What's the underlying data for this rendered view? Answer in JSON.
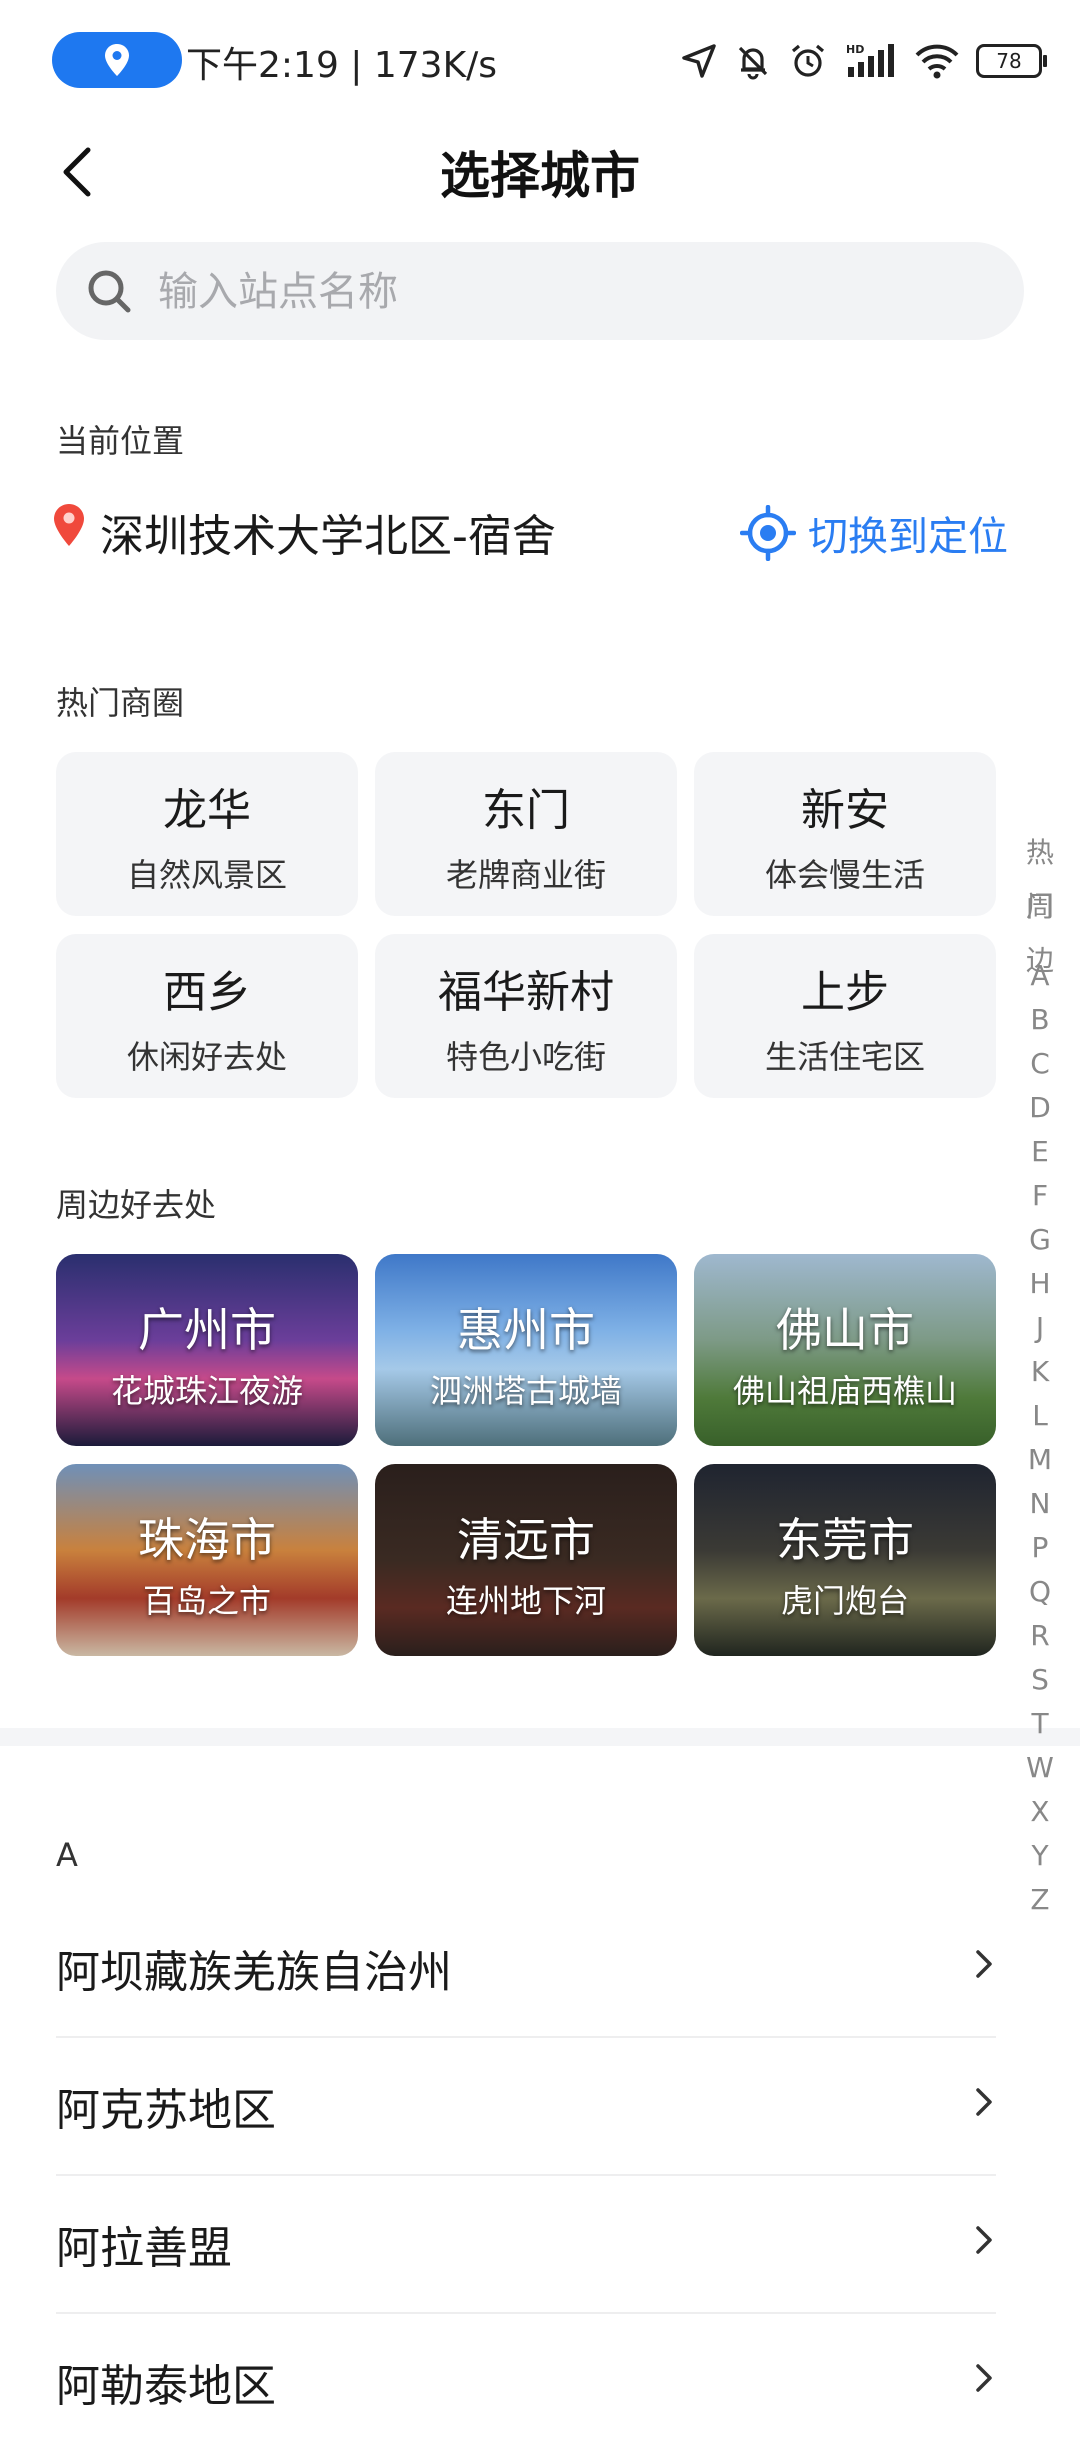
{
  "status_bar": {
    "text": "下午2:19 | 173K/s",
    "battery": "78",
    "icons": [
      "location-arrow-icon",
      "bell-off-icon",
      "alarm-icon",
      "hd-signal-icon",
      "wifi-icon",
      "battery-icon"
    ]
  },
  "header": {
    "title": "选择城市"
  },
  "search": {
    "placeholder": "输入站点名称"
  },
  "current": {
    "label": "当前位置",
    "location": "深圳技术大学北区-宿舍",
    "switch_label": "切换到定位"
  },
  "hot": {
    "label": "热门商圈",
    "items": [
      {
        "name": "龙华",
        "desc": "自然风景区"
      },
      {
        "name": "东门",
        "desc": "老牌商业街"
      },
      {
        "name": "新安",
        "desc": "体会慢生活"
      },
      {
        "name": "西乡",
        "desc": "休闲好去处"
      },
      {
        "name": "福华新村",
        "desc": "特色小吃街"
      },
      {
        "name": "上步",
        "desc": "生活住宅区"
      }
    ]
  },
  "nearby": {
    "label": "周边好去处",
    "items": [
      {
        "name": "广州市",
        "desc": "花城珠江夜游"
      },
      {
        "name": "惠州市",
        "desc": "泗洲塔古城墙"
      },
      {
        "name": "佛山市",
        "desc": "佛山祖庙西樵山"
      },
      {
        "name": "珠海市",
        "desc": "百岛之市"
      },
      {
        "name": "清远市",
        "desc": "连州地下河"
      },
      {
        "name": "东莞市",
        "desc": "虎门炮台"
      }
    ]
  },
  "index_bar": {
    "top": [
      "热门",
      "周边"
    ],
    "letters": [
      "A",
      "B",
      "C",
      "D",
      "E",
      "F",
      "G",
      "H",
      "J",
      "K",
      "L",
      "M",
      "N",
      "P",
      "Q",
      "R",
      "S",
      "T",
      "W",
      "X",
      "Y",
      "Z"
    ]
  },
  "city_list": {
    "letter": "A",
    "rows": [
      "阿坝藏族羌族自治州",
      "阿克苏地区",
      "阿拉善盟",
      "阿勒泰地区"
    ]
  },
  "colors": {
    "accent": "#2a7df2",
    "pill": "#1e78f0",
    "pin": "#f0493c",
    "chip_bg": "#f4f5f7"
  }
}
